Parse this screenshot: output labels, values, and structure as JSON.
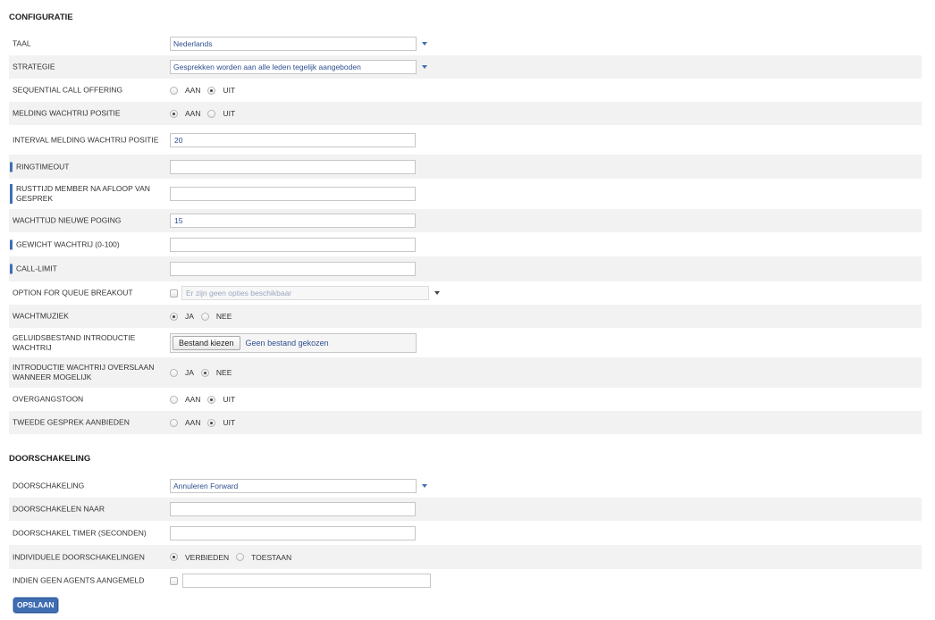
{
  "configuratie": {
    "title": "CONFIGURATIE",
    "taal": {
      "label": "TAAL",
      "value": "Nederlands"
    },
    "strategie": {
      "label": "STRATEGIE",
      "value": "Gesprekken worden aan alle leden tegelijk aangeboden"
    },
    "sequential": {
      "label": "SEQUENTIAL CALL OFFERING",
      "opt1": "AAN",
      "opt2": "UIT",
      "selected": "UIT"
    },
    "melding": {
      "label": "MELDING WACHTRIJ POSITIE",
      "opt1": "AAN",
      "opt2": "UIT",
      "selected": "AAN"
    },
    "interval": {
      "label": "INTERVAL MELDING WACHTRIJ POSITIE",
      "value": "20"
    },
    "ringtimeout": {
      "label": "RINGTIMEOUT",
      "value": ""
    },
    "rusttijd": {
      "label": "RUSTTIJD MEMBER NA AFLOOP VAN GESPREK",
      "value": ""
    },
    "wachttijd": {
      "label": "WACHTTIJD NIEUWE POGING",
      "value": "15"
    },
    "gewicht": {
      "label": "GEWICHT WACHTRIJ (0-100)",
      "value": ""
    },
    "calllimit": {
      "label": "CALL-LIMIT",
      "value": ""
    },
    "breakout": {
      "label": "OPTION FOR QUEUE BREAKOUT",
      "placeholder": "Er zijn geen opties beschikbaar"
    },
    "wachtmuziek": {
      "label": "WACHTMUZIEK",
      "opt1": "JA",
      "opt2": "NEE",
      "selected": "JA"
    },
    "geluidsbestand": {
      "label": "GELUIDSBESTAND INTRODUCTIE WACHTRIJ",
      "button": "Bestand kiezen",
      "status": "Geen bestand gekozen"
    },
    "introductie": {
      "label": "INTRODUCTIE WACHTRIJ OVERSLAAN WANNEER MOGELIJK",
      "opt1": "JA",
      "opt2": "NEE",
      "selected": "NEE"
    },
    "overgangstoon": {
      "label": "OVERGANGSTOON",
      "opt1": "AAN",
      "opt2": "UIT",
      "selected": "UIT"
    },
    "tweede": {
      "label": "TWEEDE GESPREK AANBIEDEN",
      "opt1": "AAN",
      "opt2": "UIT",
      "selected": "UIT"
    }
  },
  "doorschakeling": {
    "title": "DOORSCHAKELING",
    "doorschakeling": {
      "label": "DOORSCHAKELING",
      "value": "Annuleren Forward"
    },
    "naar": {
      "label": "DOORSCHAKELEN NAAR",
      "value": ""
    },
    "timer": {
      "label": "DOORSCHAKEL TIMER (SECONDEN)",
      "value": ""
    },
    "individuele": {
      "label": "INDIVIDUELE DOORSCHAKELINGEN",
      "opt1": "VERBIEDEN",
      "opt2": "TOESTAAN",
      "selected": "VERBIEDEN"
    },
    "geenagents": {
      "label": "INDIEN GEEN AGENTS AANGEMELD",
      "value": ""
    }
  },
  "save_label": "OPSLAAN",
  "accent_color": "#3f6eb3"
}
